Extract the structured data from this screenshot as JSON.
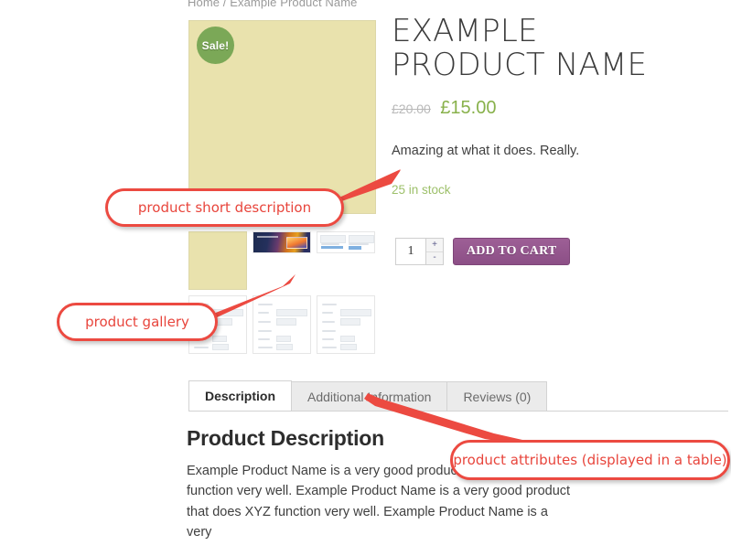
{
  "breadcrumb": {
    "text": "Home / Example Product Name"
  },
  "product": {
    "badge": "Sale!",
    "title": "EXAMPLE PRODUCT NAME",
    "price_old": "£20.00",
    "price_new": "£15.00",
    "short_description": "Amazing at what it does. Really.",
    "stock": "25 in stock"
  },
  "cart": {
    "quantity": "1",
    "qty_increase": "+",
    "qty_decrease": "-",
    "add_to_cart_label": "ADD TO CART"
  },
  "tabs": [
    {
      "label": "Description",
      "active": true
    },
    {
      "label": "Additional Information",
      "active": false
    },
    {
      "label": "Reviews (0)",
      "active": false
    }
  ],
  "description": {
    "heading": "Product Description",
    "body": "Example Product Name is a very good product that does XYZ function very well. Example Product Name is a very good product that does XYZ function very well. Example Product Name is a very"
  },
  "annotations": [
    {
      "label": "product short description"
    },
    {
      "label": "product gallery"
    },
    {
      "label": "product attributes (displayed in a table)"
    }
  ],
  "colors": {
    "accent_red": "#ec4a41",
    "sale_green": "#7ba857",
    "price_green": "#88b14b",
    "button_purple": "#8c4f86",
    "product_beige": "#e9e2ad"
  }
}
